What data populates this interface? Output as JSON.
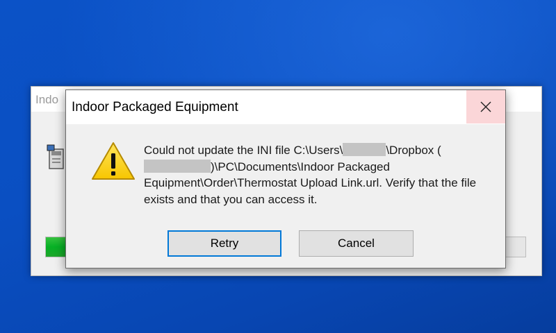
{
  "background_window": {
    "title": "Indo"
  },
  "dialog": {
    "title": "Indoor Packaged Equipment",
    "close_icon": "close-icon",
    "warning_icon": "warning-icon",
    "message": {
      "part1": "Could not update the INI file C:\\Users\\",
      "part2": "\\Dropbox (",
      "part3": ")\\PC\\Documents\\Indoor Packaged Equipment\\Order\\Thermostat Upload Link.url.  Verify that the file exists and that you can access it."
    },
    "buttons": {
      "retry_label": "Retry",
      "cancel_label": "Cancel"
    }
  },
  "progress": {
    "fraction": 0.045
  },
  "colors": {
    "desktop": "#0a4fc2",
    "progress_fill": "#06b025",
    "close_hover": "#fbd6d8",
    "default_button_border": "#0078d7"
  }
}
